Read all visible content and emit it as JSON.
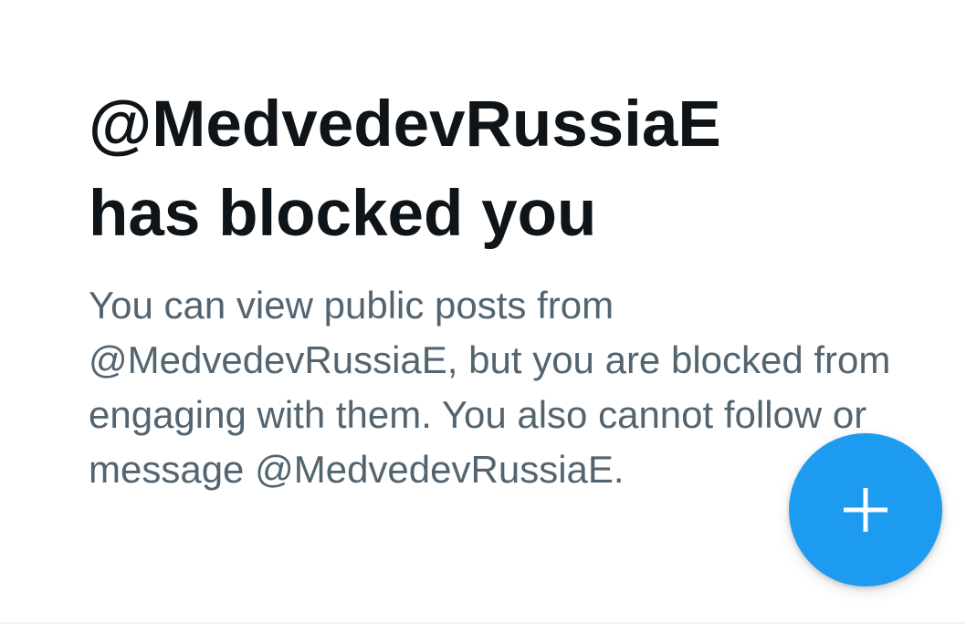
{
  "blocked_notice": {
    "headline_line1": "@MedvedevRussiaE",
    "headline_line2": "has blocked you",
    "body": "You can view public posts from @MedvedevRussiaE, but you are blocked from engaging with them. You also cannot follow or message @MedvedevRussiaE."
  },
  "fab": {
    "icon": "plus-icon",
    "color": "#1d9bf0"
  },
  "colors": {
    "headline": "#0f1419",
    "body": "#536471",
    "accent": "#1d9bf0",
    "background": "#ffffff"
  }
}
